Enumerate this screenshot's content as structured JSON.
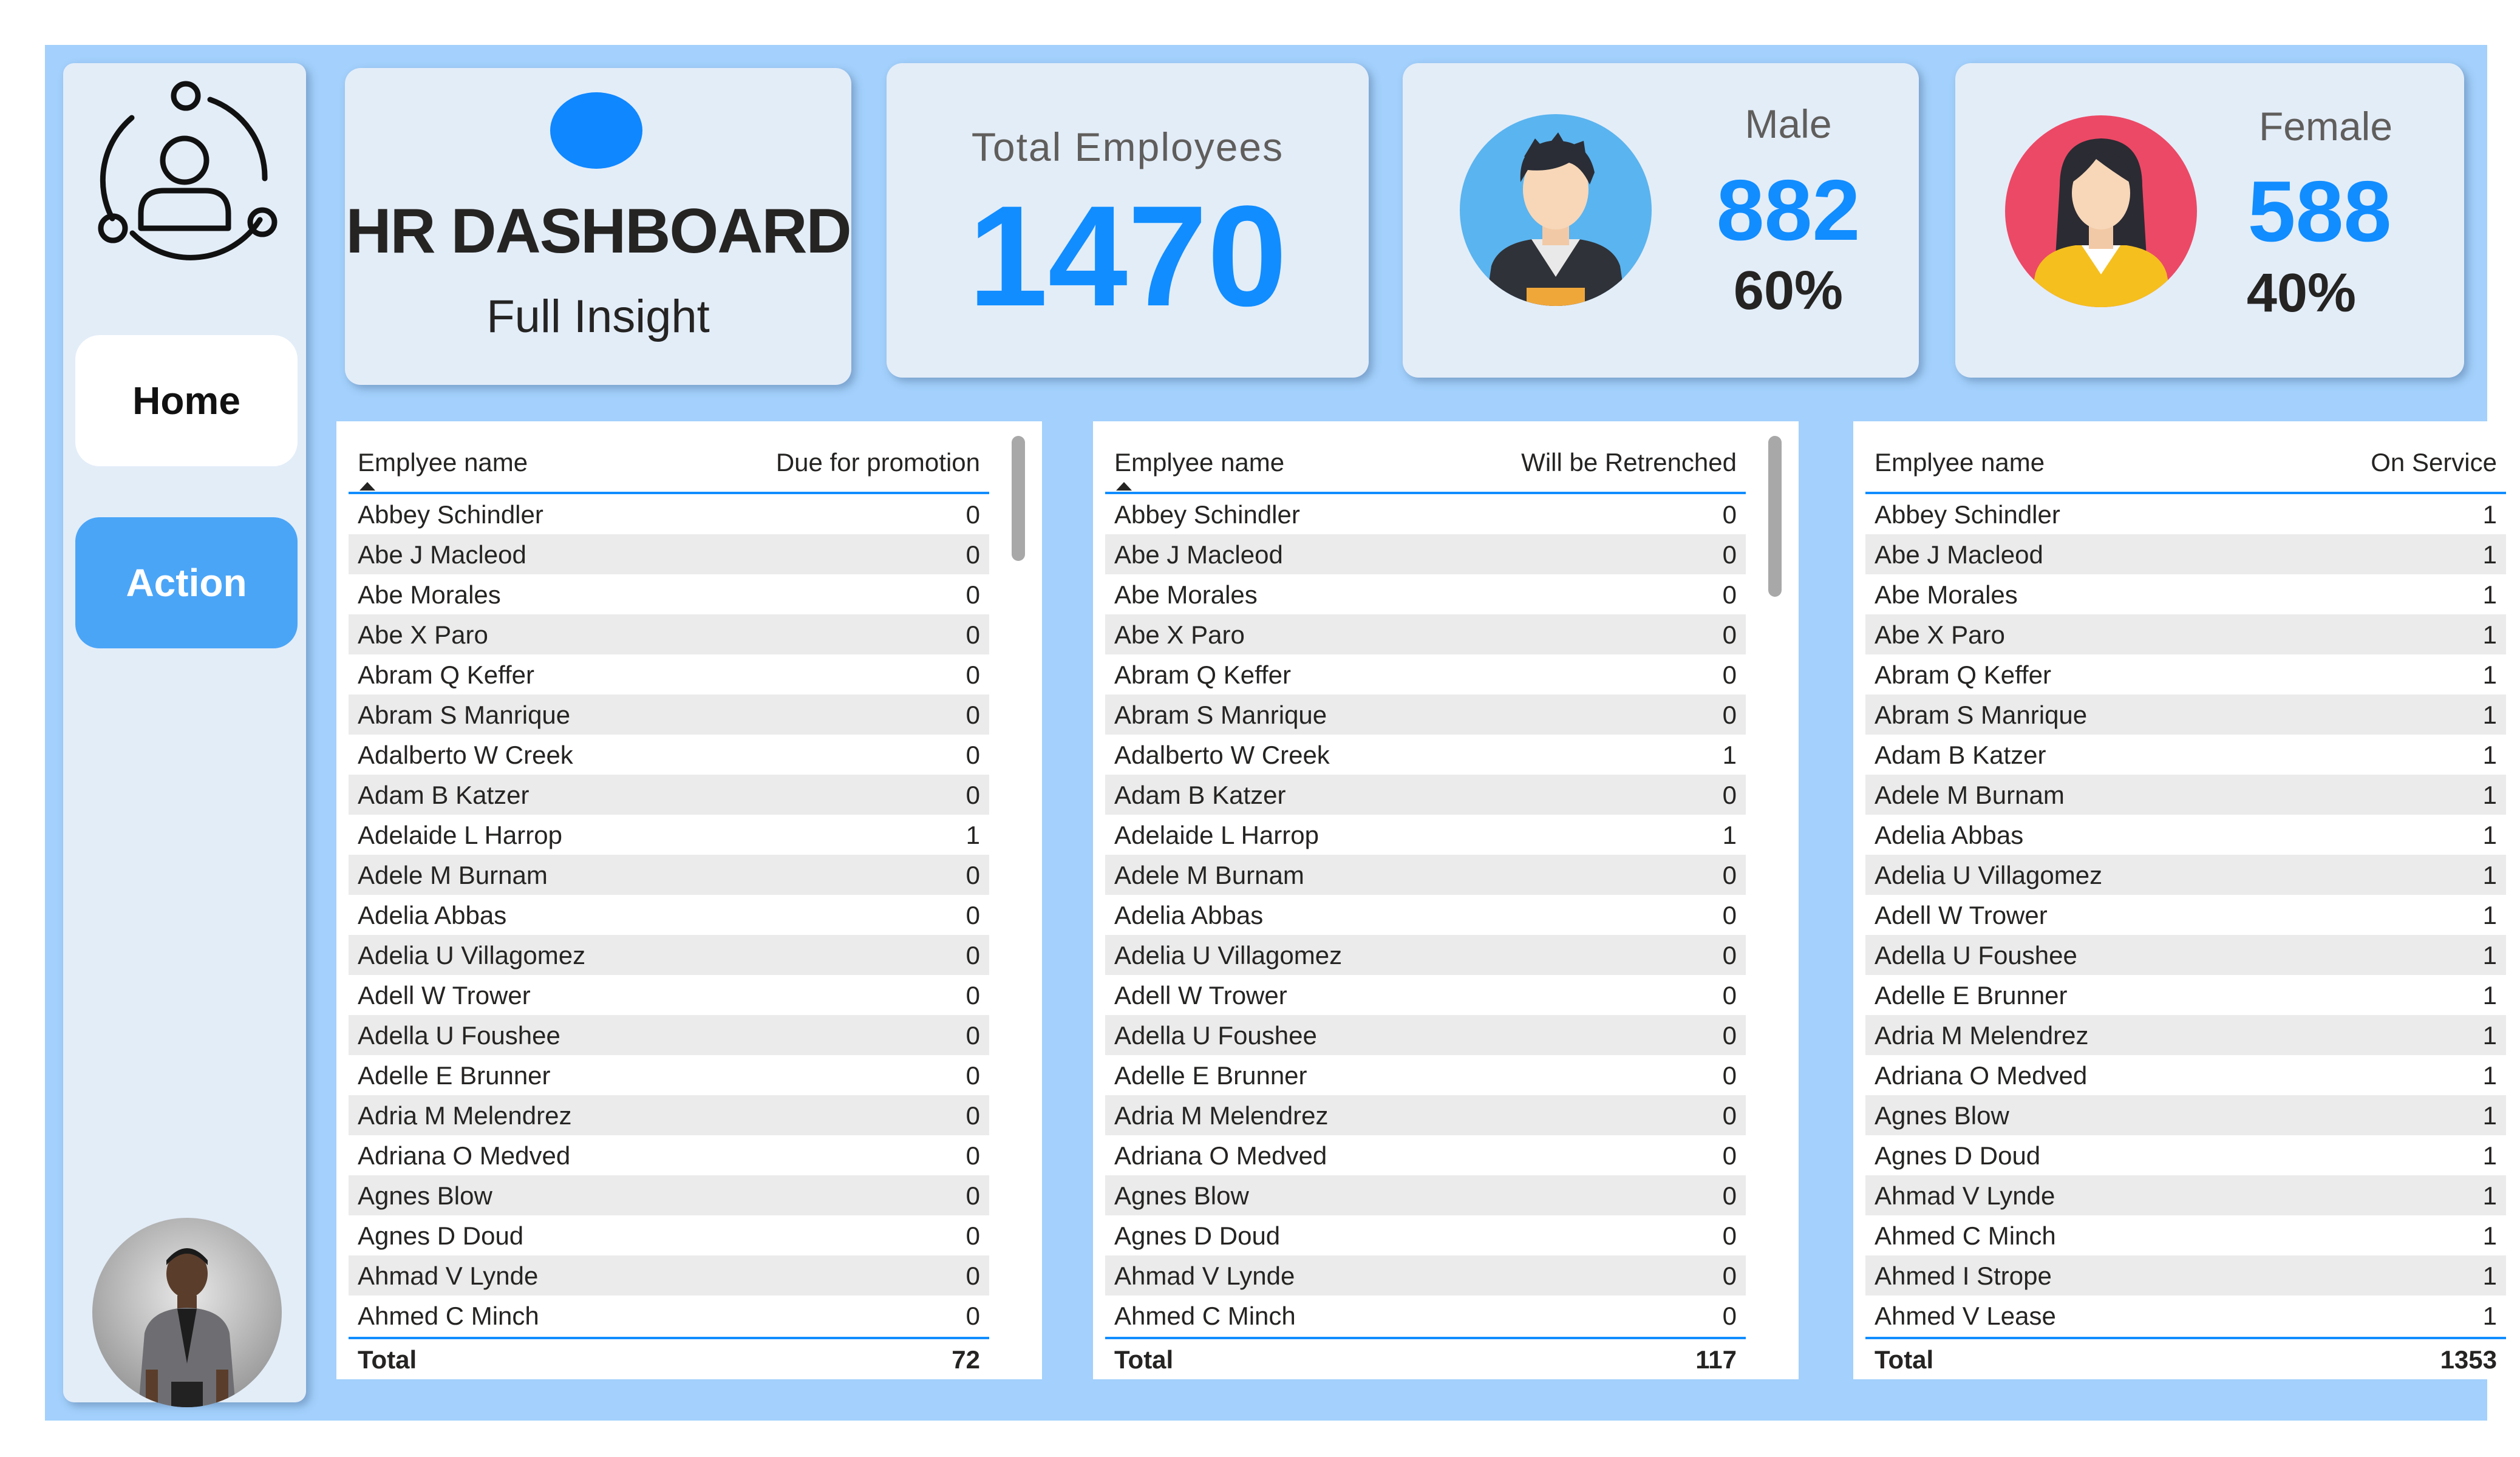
{
  "app": {
    "title": "HR DASHBOARD",
    "subtitle": "Full Insight"
  },
  "nav": {
    "home_label": "Home",
    "action_label": "Action"
  },
  "kpis": {
    "total_label": "Total Employees",
    "total_value": "1470",
    "male_label": "Male",
    "male_count": "882",
    "male_pct": "60%",
    "female_label": "Female",
    "female_count": "588",
    "female_pct": "40%"
  },
  "colors": {
    "accent": "#118dff",
    "background": "#a3d0fc",
    "card": "#e3edf8"
  },
  "icons": {
    "logo": "user-network-icon",
    "male": "male-avatar-icon",
    "female": "female-avatar-icon",
    "profile": "profile-photo"
  },
  "tables": [
    {
      "name_header": "Emplyee name",
      "value_header": "Due for promotion",
      "rows": [
        {
          "name": "Abbey Schindler",
          "value": "0"
        },
        {
          "name": "Abe J Macleod",
          "value": "0"
        },
        {
          "name": "Abe Morales",
          "value": "0"
        },
        {
          "name": "Abe X Paro",
          "value": "0"
        },
        {
          "name": "Abram Q Keffer",
          "value": "0"
        },
        {
          "name": "Abram S Manrique",
          "value": "0"
        },
        {
          "name": "Adalberto W Creek",
          "value": "0"
        },
        {
          "name": "Adam B Katzer",
          "value": "0"
        },
        {
          "name": "Adelaide L Harrop",
          "value": "1"
        },
        {
          "name": "Adele M Burnam",
          "value": "0"
        },
        {
          "name": "Adelia Abbas",
          "value": "0"
        },
        {
          "name": "Adelia U Villagomez",
          "value": "0"
        },
        {
          "name": "Adell W Trower",
          "value": "0"
        },
        {
          "name": "Adella U Foushee",
          "value": "0"
        },
        {
          "name": "Adelle E Brunner",
          "value": "0"
        },
        {
          "name": "Adria M Melendrez",
          "value": "0"
        },
        {
          "name": "Adriana O Medved",
          "value": "0"
        },
        {
          "name": "Agnes Blow",
          "value": "0"
        },
        {
          "name": "Agnes D Doud",
          "value": "0"
        },
        {
          "name": "Ahmad V Lynde",
          "value": "0"
        },
        {
          "name": "Ahmed C Minch",
          "value": "0"
        }
      ],
      "total_label": "Total",
      "total_value": "72",
      "scroll_fraction_start": 0.0,
      "scroll_fraction_size": 0.14
    },
    {
      "name_header": "Emplyee name",
      "value_header": "Will be Retrenched",
      "rows": [
        {
          "name": "Abbey Schindler",
          "value": "0"
        },
        {
          "name": "Abe J Macleod",
          "value": "0"
        },
        {
          "name": "Abe Morales",
          "value": "0"
        },
        {
          "name": "Abe X Paro",
          "value": "0"
        },
        {
          "name": "Abram Q Keffer",
          "value": "0"
        },
        {
          "name": "Abram S Manrique",
          "value": "0"
        },
        {
          "name": "Adalberto W Creek",
          "value": "1"
        },
        {
          "name": "Adam B Katzer",
          "value": "0"
        },
        {
          "name": "Adelaide L Harrop",
          "value": "1"
        },
        {
          "name": "Adele M Burnam",
          "value": "0"
        },
        {
          "name": "Adelia Abbas",
          "value": "0"
        },
        {
          "name": "Adelia U Villagomez",
          "value": "0"
        },
        {
          "name": "Adell W Trower",
          "value": "0"
        },
        {
          "name": "Adella U Foushee",
          "value": "0"
        },
        {
          "name": "Adelle E Brunner",
          "value": "0"
        },
        {
          "name": "Adria M Melendrez",
          "value": "0"
        },
        {
          "name": "Adriana O Medved",
          "value": "0"
        },
        {
          "name": "Agnes Blow",
          "value": "0"
        },
        {
          "name": "Agnes D Doud",
          "value": "0"
        },
        {
          "name": "Ahmad V Lynde",
          "value": "0"
        },
        {
          "name": "Ahmed C Minch",
          "value": "0"
        }
      ],
      "total_label": "Total",
      "total_value": "117",
      "scroll_fraction_start": 0.0,
      "scroll_fraction_size": 0.18
    },
    {
      "name_header": "Emplyee name",
      "value_header": "On Service",
      "rows": [
        {
          "name": "Abbey Schindler",
          "value": "1"
        },
        {
          "name": "Abe J Macleod",
          "value": "1"
        },
        {
          "name": "Abe Morales",
          "value": "1"
        },
        {
          "name": "Abe X Paro",
          "value": "1"
        },
        {
          "name": "Abram Q Keffer",
          "value": "1"
        },
        {
          "name": "Abram S Manrique",
          "value": "1"
        },
        {
          "name": "Adam B Katzer",
          "value": "1"
        },
        {
          "name": "Adele M Burnam",
          "value": "1"
        },
        {
          "name": "Adelia Abbas",
          "value": "1"
        },
        {
          "name": "Adelia U Villagomez",
          "value": "1"
        },
        {
          "name": "Adell W Trower",
          "value": "1"
        },
        {
          "name": "Adella U Foushee",
          "value": "1"
        },
        {
          "name": "Adelle E Brunner",
          "value": "1"
        },
        {
          "name": "Adria M Melendrez",
          "value": "1"
        },
        {
          "name": "Adriana O Medved",
          "value": "1"
        },
        {
          "name": "Agnes Blow",
          "value": "1"
        },
        {
          "name": "Agnes D Doud",
          "value": "1"
        },
        {
          "name": "Ahmad V Lynde",
          "value": "1"
        },
        {
          "name": "Ahmed C Minch",
          "value": "1"
        },
        {
          "name": "Ahmed I Strope",
          "value": "1"
        },
        {
          "name": "Ahmed V Lease",
          "value": "1"
        }
      ],
      "total_label": "Total",
      "total_value": "1353",
      "scroll_fraction_start": 0.0,
      "scroll_fraction_size": 0.08
    }
  ]
}
